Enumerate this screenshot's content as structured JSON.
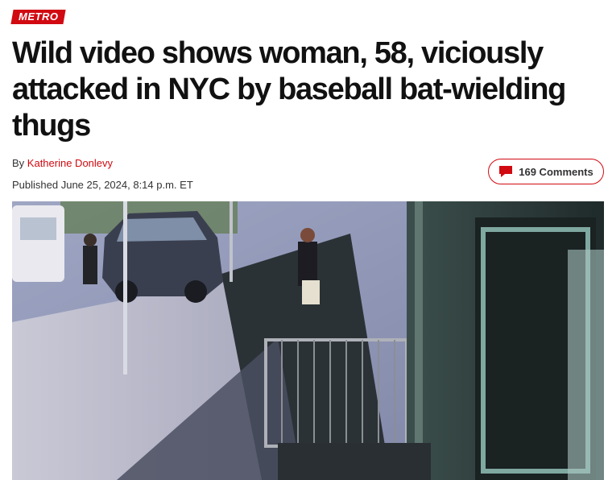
{
  "article": {
    "section_label": "METRO",
    "headline": "Wild video shows woman, 58, viciously attacked in NYC by baseball bat-wielding thugs",
    "byline_prefix": "By",
    "author": "Katherine Donlevy",
    "published": "Published June 25, 2024, 8:14 p.m. ET",
    "comments_label": "169 Comments"
  },
  "colors": {
    "brand_red": "#d10a11"
  },
  "icons": {
    "comments": "speech-bubble-icon"
  }
}
